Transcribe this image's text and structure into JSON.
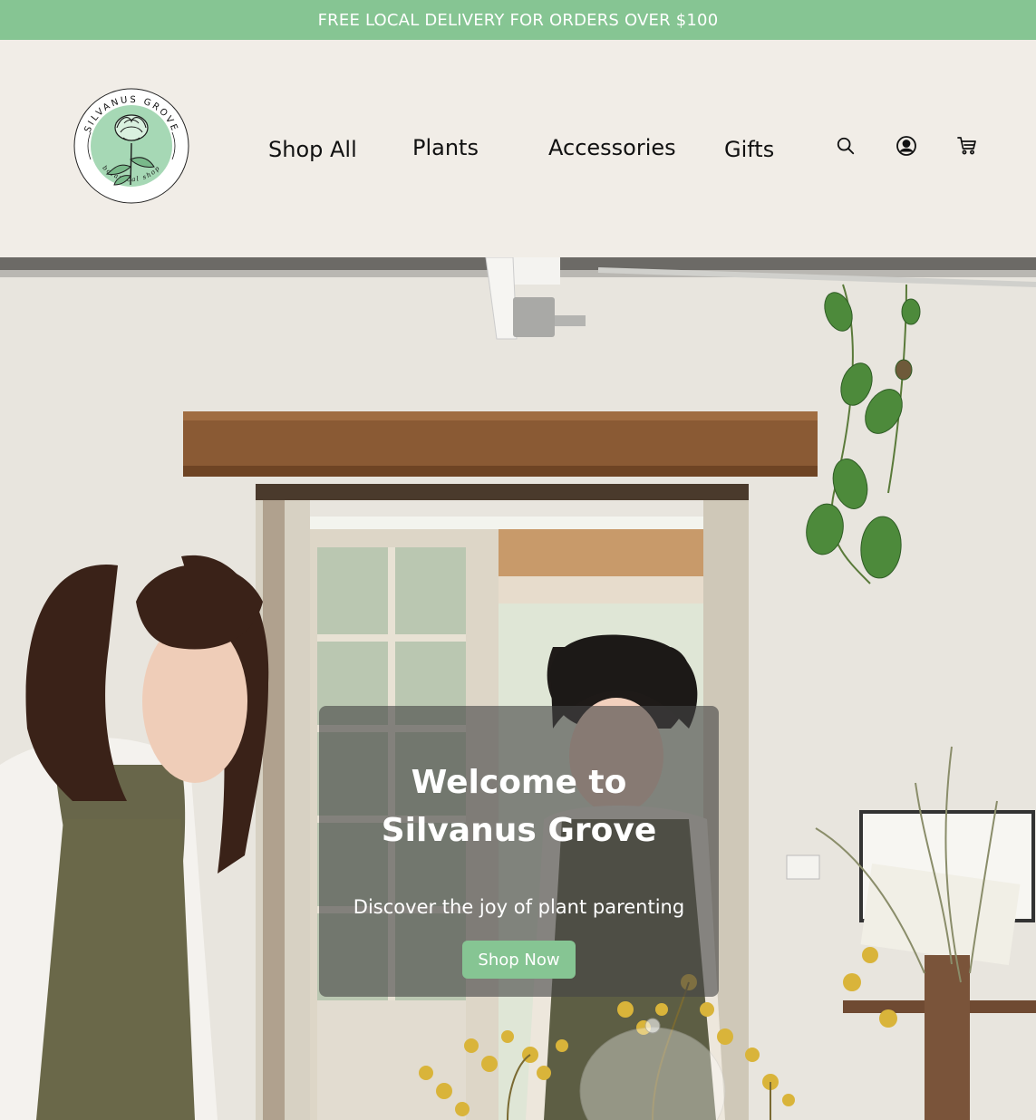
{
  "promo_bar": {
    "text": "FREE LOCAL DELIVERY FOR ORDERS OVER $100"
  },
  "logo": {
    "brand_name": "SILVANUS GROVE",
    "tagline": "botanical shop"
  },
  "nav": {
    "items": [
      {
        "label": "Shop All"
      },
      {
        "label": "Plants"
      },
      {
        "label": "Accessories"
      },
      {
        "label": "Gifts"
      }
    ]
  },
  "header_icons": [
    "search-icon",
    "account-icon",
    "cart-icon"
  ],
  "hero": {
    "title": "Welcome to Silvanus Grove",
    "subtitle": "Discover the joy of plant parenting",
    "cta_label": "Shop Now"
  },
  "colors": {
    "accent_green": "#86c593",
    "header_bg": "#f1ede7",
    "text_dark": "#111111"
  }
}
